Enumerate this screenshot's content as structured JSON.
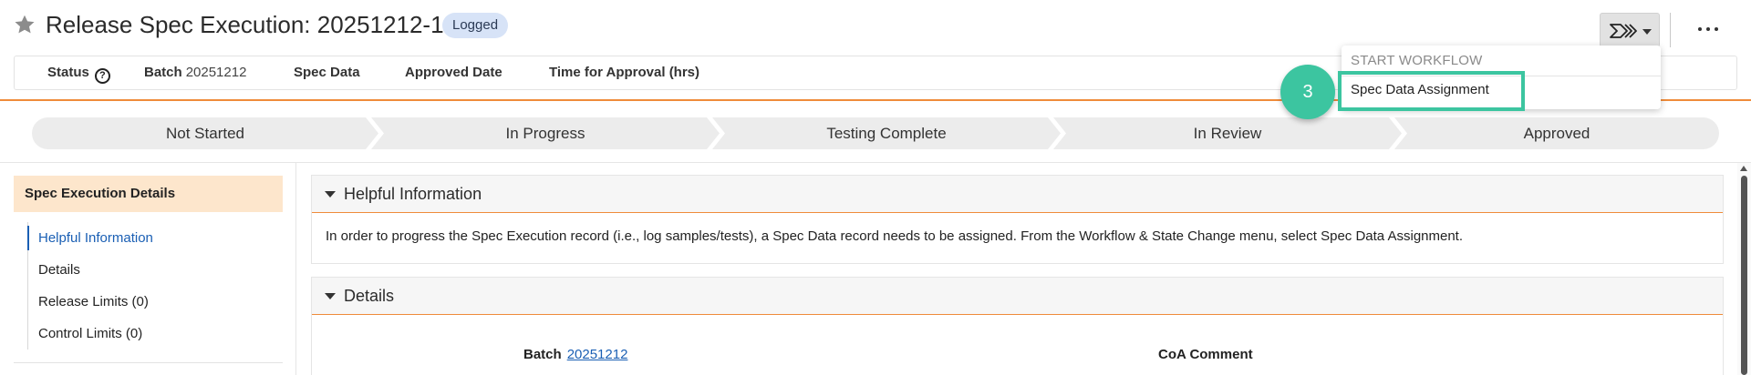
{
  "header": {
    "title": "Release Spec Execution: 20251212-1",
    "status_badge": "Logged",
    "star_icon": "star-icon",
    "workflow_icon": "workflow-chevrons-icon",
    "more_icon": "more-horizontal-icon"
  },
  "summary": {
    "status_label": "Status",
    "batch_label": "Batch",
    "batch_value": "20251212",
    "spec_data_label": "Spec Data",
    "approved_date_label": "Approved Date",
    "time_for_approval_label": "Time for Approval (hrs)"
  },
  "lifecycle": {
    "stages": [
      "Not Started",
      "In Progress",
      "Testing Complete",
      "In Review",
      "Approved"
    ]
  },
  "sidebar": {
    "title": "Spec Execution Details",
    "items": [
      {
        "label": "Helpful Information",
        "active": true
      },
      {
        "label": "Details"
      },
      {
        "label": "Release Limits (0)"
      },
      {
        "label": "Control Limits (0)"
      }
    ]
  },
  "sections": {
    "helpful": {
      "title": "Helpful Information",
      "text": "In order to progress the Spec Execution record (i.e., log samples/tests), a Spec Data record needs to be assigned. From the Workflow & State Change menu, select Spec Data Assignment."
    },
    "details": {
      "title": "Details",
      "batch_label": "Batch",
      "batch_value": "20251212",
      "coa_label": "CoA Comment"
    }
  },
  "workflow_menu": {
    "header": "START WORKFLOW",
    "items": [
      "Spec Data Assignment"
    ],
    "step_number": "3"
  },
  "colors": {
    "accent_orange": "#ef8b3a",
    "link_blue": "#1a5fb4",
    "badge_bg": "#d7e3f7",
    "highlight_green": "#3cc5a0",
    "sidebar_header_bg": "#fde6cc"
  }
}
